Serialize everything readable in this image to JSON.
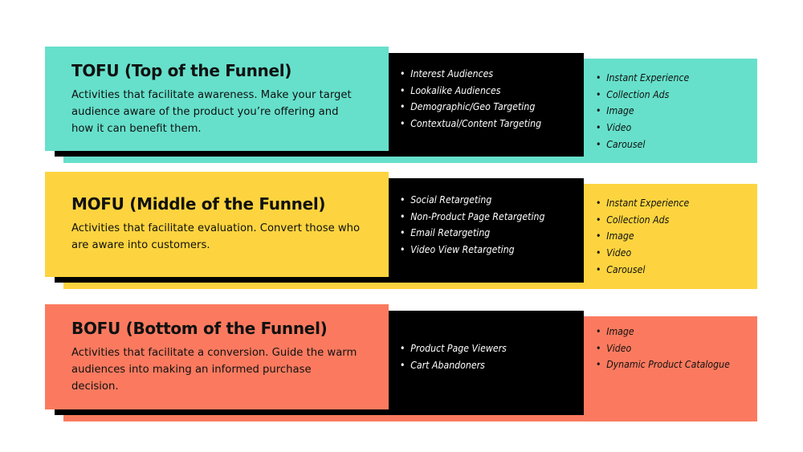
{
  "colors": {
    "tofu": "#66e0cb",
    "mofu": "#fdd43f",
    "bofu": "#fb7a5f",
    "black": "#000000"
  },
  "stages": [
    {
      "key": "tofu",
      "title": "TOFU (Top of the Funnel)",
      "description": "Activities that facilitate awareness. Make your target audience aware of the product you’re offering and how it can benefit them.",
      "audiences": [
        "Interest Audiences",
        "Lookalike Audiences",
        "Demographic/Geo Targeting",
        "Contextual/Content Targeting"
      ],
      "formats": [
        "Instant Experience",
        "Collection Ads",
        "Image",
        "Video",
        "Carousel"
      ]
    },
    {
      "key": "mofu",
      "title": "MOFU (Middle of the Funnel)",
      "description": "Activities that facilitate evaluation. Convert those who are aware into customers.",
      "audiences": [
        "Social Retargeting",
        "Non-Product Page Retargeting",
        "Email Retargeting",
        "Video View Retargeting"
      ],
      "formats": [
        "Instant Experience",
        "Collection Ads",
        "Image",
        "Video",
        "Carousel"
      ]
    },
    {
      "key": "bofu",
      "title": "BOFU (Bottom of the Funnel)",
      "description": "Activities that facilitate a conversion. Guide the warm audiences into making an informed purchase decision.",
      "audiences": [
        "Product Page Viewers",
        "Cart Abandoners"
      ],
      "formats": [
        "Image",
        "Video",
        "Dynamic Product Catalogue"
      ]
    }
  ]
}
